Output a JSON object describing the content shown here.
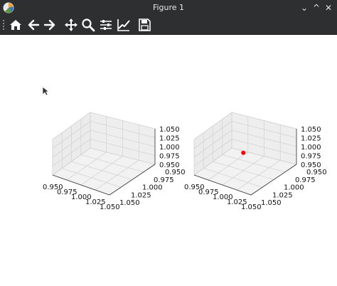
{
  "window": {
    "title": "Figure 1",
    "controls": {
      "minimize": "⌄",
      "maximize": "^",
      "close": "✕"
    }
  },
  "toolbar": {
    "buttons": [
      {
        "icon": "home-icon",
        "tooltip": "Home"
      },
      {
        "icon": "back-arrow-icon",
        "tooltip": "Back"
      },
      {
        "icon": "forward-arrow-icon",
        "tooltip": "Forward"
      },
      {
        "icon": "pan-move-icon",
        "tooltip": "Pan"
      },
      {
        "icon": "zoom-magnifier-icon",
        "tooltip": "Zoom"
      },
      {
        "icon": "configure-subplots-icon",
        "tooltip": "Subplots"
      },
      {
        "icon": "edit-axis-line-icon",
        "tooltip": "Customize"
      },
      {
        "icon": "save-floppy-icon",
        "tooltip": "Save"
      }
    ]
  },
  "colors": {
    "window_bg": "#2e2f31",
    "toolbar_icon": "#ffffff",
    "pane_face": "#f2f2f2",
    "grid": "#d4d4d4",
    "point": "#ff0000"
  },
  "chart_data": [
    {
      "type": "scatter",
      "projection": "3d",
      "x_ticks": [
        "0.950",
        "0.975",
        "1.000",
        "1.025",
        "1.050"
      ],
      "y_ticks": [
        "0.950",
        "0.975",
        "1.000",
        "1.025",
        "1.050"
      ],
      "z_ticks": [
        "0.950",
        "0.975",
        "1.000",
        "1.025",
        "1.050"
      ],
      "xlim": [
        0.95,
        1.05
      ],
      "ylim": [
        0.95,
        1.05
      ],
      "zlim": [
        0.95,
        1.05
      ],
      "points": [],
      "grid": true
    },
    {
      "type": "scatter",
      "projection": "3d",
      "x_ticks": [
        "0.950",
        "0.975",
        "1.000",
        "1.025",
        "1.050"
      ],
      "y_ticks": [
        "0.950",
        "0.975",
        "1.000",
        "1.025",
        "1.050"
      ],
      "z_ticks": [
        "0.950",
        "0.975",
        "1.000",
        "1.025",
        "1.050"
      ],
      "xlim": [
        0.95,
        1.05
      ],
      "ylim": [
        0.95,
        1.05
      ],
      "zlim": [
        0.95,
        1.05
      ],
      "points": [
        {
          "x": 1.0,
          "y": 1.0,
          "z": 1.0,
          "color": "#ff0000"
        }
      ],
      "grid": true
    }
  ]
}
